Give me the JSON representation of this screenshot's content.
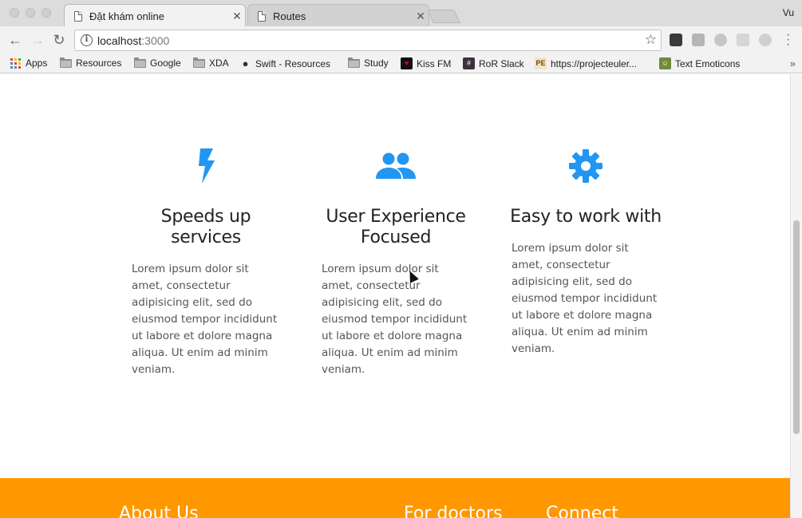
{
  "browser": {
    "tabs": [
      {
        "label": "Đặt khám online",
        "active": true
      },
      {
        "label": "Routes",
        "active": false
      }
    ],
    "profile": "Vu",
    "address": {
      "host": "localhost",
      "port": ":3000"
    }
  },
  "bookmarks": [
    {
      "label": "Apps",
      "icon": "apps-grid-icon"
    },
    {
      "label": "Resources",
      "icon": "folder-icon"
    },
    {
      "label": "Google",
      "icon": "folder-icon"
    },
    {
      "label": "XDA",
      "icon": "folder-icon"
    },
    {
      "label": "Swift - Resources",
      "icon": "apple-icon"
    },
    {
      "label": "Study",
      "icon": "folder-icon"
    },
    {
      "label": "Kiss FM",
      "icon": "kiss-fm-icon"
    },
    {
      "label": "RoR Slack",
      "icon": "slack-icon"
    },
    {
      "label": "https://projecteuler...",
      "icon": "project-euler-icon"
    },
    {
      "label": "Text Emoticons",
      "icon": "emoticon-icon"
    }
  ],
  "features": [
    {
      "icon": "lightning-bolt-icon",
      "title_line1": "Speeds up",
      "title_line2": "services",
      "body": "Lorem ipsum dolor sit amet, consectetur adipisicing elit, sed do eiusmod tempor incididunt ut labore et dolore magna aliqua. Ut enim ad minim veniam."
    },
    {
      "icon": "users-group-icon",
      "title_line1": "User Experience",
      "title_line2": "Focused",
      "body": "Lorem ipsum dolor sit amet, consectetur adipisicing elit, sed do eiusmod tempor incididunt ut labore et dolore magna aliqua. Ut enim ad minim veniam."
    },
    {
      "icon": "gear-icon",
      "title_line1": "Easy to work with",
      "title_line2": "",
      "body": "Lorem ipsum dolor sit amet, consectetur adipisicing elit, sed do eiusmod tempor incididunt ut labore et dolore magna aliqua. Ut enim ad minim veniam."
    }
  ],
  "footer": {
    "about": "About Us",
    "doctors": "For doctors",
    "connect": "Connect"
  },
  "colors": {
    "accent": "#2196f3",
    "footer": "#ff9800"
  }
}
